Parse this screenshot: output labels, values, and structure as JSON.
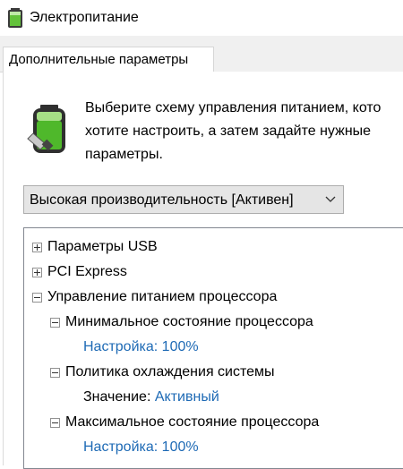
{
  "window": {
    "title": "Электропитание",
    "app_icon": "power-options-icon"
  },
  "tabs": [
    {
      "label": "Дополнительные параметры",
      "active": true
    }
  ],
  "description": {
    "icon": "battery-plug-icon",
    "text": "Выберите схему управления питанием, кото\nхотите настроить, а затем задайте нужные\nпараметры."
  },
  "plan_select": {
    "value": "Высокая производительность [Активен]",
    "icon": "chevron-down-icon"
  },
  "tree": {
    "items": [
      {
        "label": "Параметры USB",
        "expander": "plus"
      },
      {
        "label": "PCI Express",
        "expander": "plus"
      },
      {
        "label": "Управление питанием процессора",
        "expander": "minus"
      },
      {
        "label": "Минимальное состояние процессора",
        "expander": "minus"
      },
      {
        "setting_label": "Настройка:",
        "setting_value": "100%"
      },
      {
        "label": "Политика охлаждения системы",
        "expander": "minus"
      },
      {
        "setting_label": "Значение:",
        "setting_value": "Активный"
      },
      {
        "label": "Максимальное состояние процессора",
        "expander": "minus"
      },
      {
        "setting_label": "Настройка:",
        "setting_value": "100%"
      }
    ]
  },
  "colors": {
    "link": "#1e6ab5",
    "select_bg": "#e5e5e5",
    "tab_strip": "#f0f0f0"
  }
}
